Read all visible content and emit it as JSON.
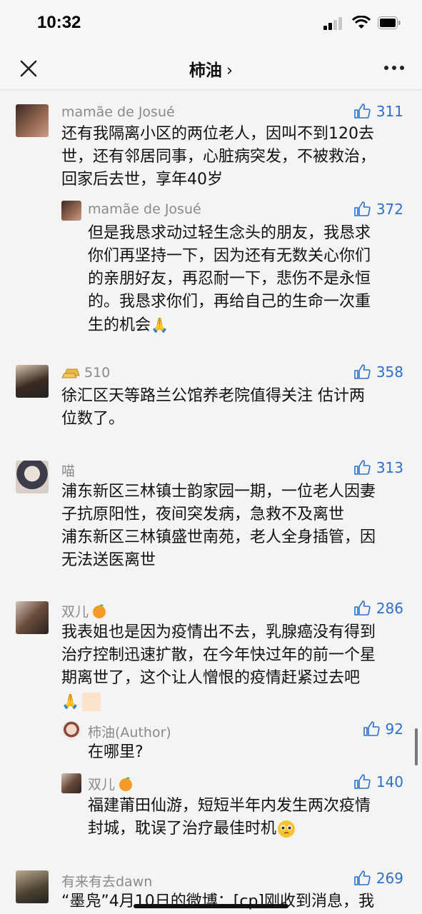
{
  "status": {
    "time": "10:32"
  },
  "nav": {
    "title": "柿油",
    "chevron": "›"
  },
  "comments": [
    {
      "user": "mamãe de Josué",
      "likes": "311",
      "lines": [
        "还有我隔离小区的两位老人，因叫不到120去",
        "世，还有邻居同事，心脏病突发，不被救治，",
        "回家后去世，享年40岁"
      ],
      "avatar_color": "#6b4a3a"
    },
    {
      "user": "mamãe de Josué",
      "likes": "372",
      "lines": [
        "但是我恳求动过轻生念头的朋友，我恳求",
        "你们再坚持一下，因为还有无数关心你们",
        "的亲朋好友，再忍耐一下，悲伤不是永恒",
        "的。我恳求你们，再给自己的生命一次重",
        "生的机会"
      ],
      "avatar_color": "#6b4a3a"
    },
    {
      "user": "510",
      "likes": "358",
      "lines": [
        "徐汇区天等路兰公馆养老院值得关注 估计两",
        "位数了。"
      ],
      "avatar_color": "#3a3a3a"
    },
    {
      "user": "喵",
      "likes": "313",
      "lines": [
        "浦东新区三林镇士韵家园一期，一位老人因妻",
        "子抗原阳性，夜间突发病，急救不及离世",
        "浦东新区三林镇盛世南苑，老人全身插管，因",
        "无法送医离世"
      ],
      "avatar_color": "#5a5a6a"
    },
    {
      "user": "双儿",
      "likes": "286",
      "lines": [
        "我表姐也是因为疫情出不去，乳腺癌没有得到",
        "治疗控制迅速扩散，在今年快过年的前一个星",
        "期离世了，这个让人憎恨的疫情赶紧过去吧"
      ],
      "avatar_color": "#8a6a5a"
    },
    {
      "user": "柿油(Author)",
      "likes": "92",
      "lines": [
        "在哪里?"
      ],
      "avatar_color": "#d9c7b8"
    },
    {
      "user": "双儿",
      "likes": "140",
      "lines": [
        "福建莆田仙游，短短半年内发生两次疫情",
        "封城，耽误了治疗最佳时机"
      ],
      "avatar_color": "#8a6a5a"
    },
    {
      "user": "有来有去dawn",
      "likes": "269",
      "lines": [
        "“墨凫”4月10日的微博：[cp]刚收到消息，我"
      ],
      "avatar_color": "#5a5a4a"
    }
  ],
  "icons": {
    "close": "close-icon",
    "more": "more-icon",
    "like": "thumb-up-icon",
    "pray": "pray-emoji",
    "orange": "orange-emoji",
    "gold": "gold-bar-icon",
    "pleading": "pleading-emoji"
  },
  "colors": {
    "like": "#2d6fcc",
    "username": "#8a8a8a",
    "background": "#f4f4f4"
  }
}
